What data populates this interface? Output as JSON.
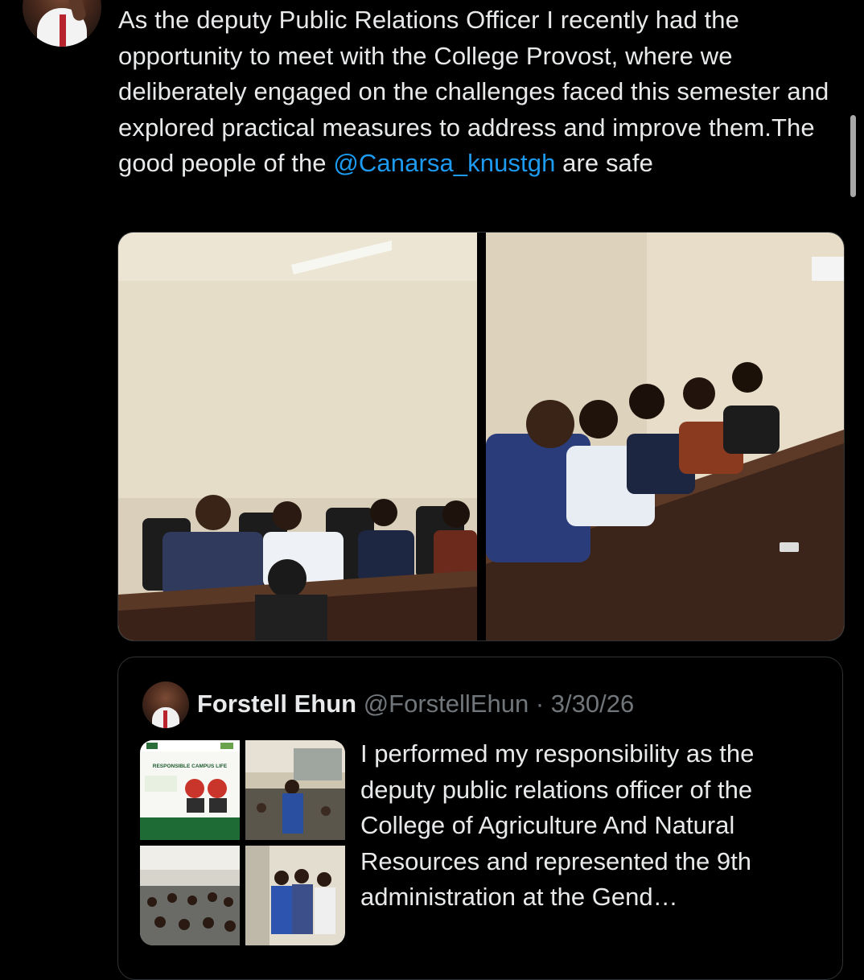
{
  "tweet": {
    "text_before_mention": "As the deputy Public Relations Officer I recently had the opportunity to meet with the College Provost, where we deliberately engaged on the challenges faced this semester and explored practical measures to address and improve them.The good people of the",
    "mention": "@Canarsa_knustgh",
    "text_after_mention": " are safe"
  },
  "quoted_tweet": {
    "name": "Forstell Ehun",
    "handle": "@ForstellEhun",
    "separator": "·",
    "date": "3/30/26",
    "text": "I performed my responsibility as the deputy public relations officer of the College of Agriculture And Natural Resources and represented the 9th administration at the Gend…",
    "thumbnail_poster_title": "RESPONSIBLE CAMPUS LIFE"
  }
}
